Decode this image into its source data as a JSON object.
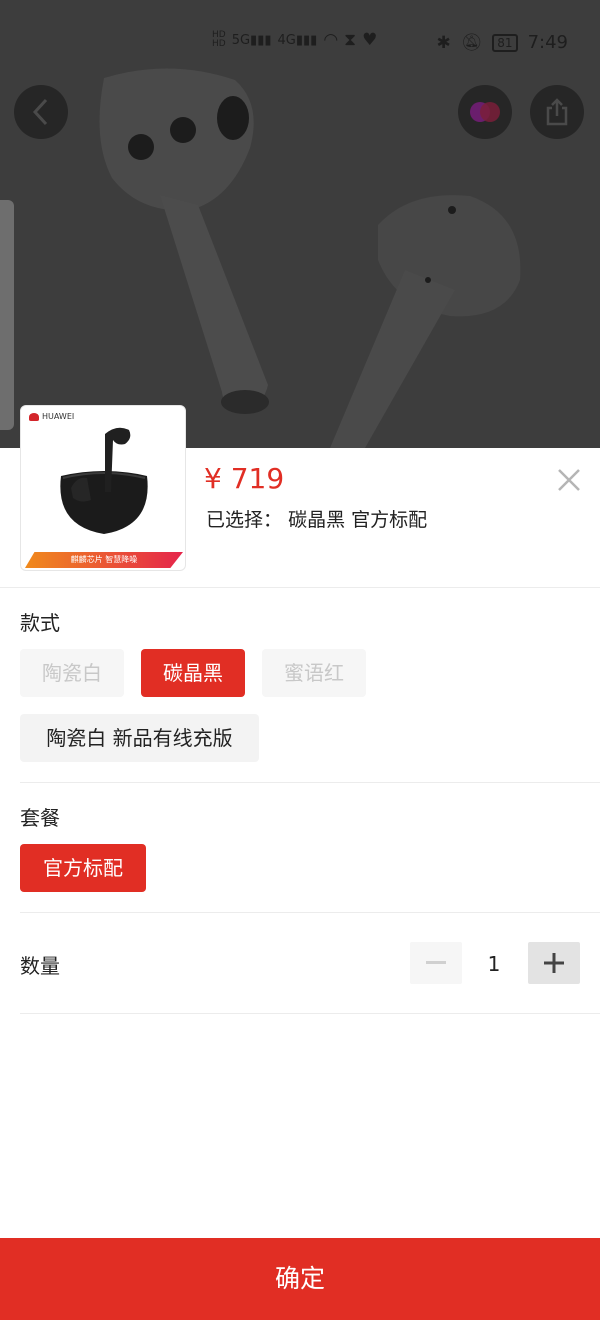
{
  "status_bar": {
    "left_icons": [
      "hd-icon",
      "signal-5g-icon",
      "signal-4g-icon",
      "wifi-icon",
      "hourglass-icon",
      "health-icon"
    ],
    "battery": "81",
    "time": "7:49"
  },
  "header_icons": [
    "back-icon",
    "color-swatch-icon",
    "share-icon"
  ],
  "product": {
    "thumb_brand": "HUAWEI",
    "thumb_ribbon": "麒麟芯片 智慧降噪",
    "price": "¥ 719",
    "selected_label": "已选择：",
    "selected_value": "碳晶黑 官方标配"
  },
  "style_section": {
    "title": "款式",
    "options": [
      {
        "label": "陶瓷白",
        "state": "disabled"
      },
      {
        "label": "碳晶黑",
        "state": "active"
      },
      {
        "label": "蜜语红",
        "state": "disabled"
      },
      {
        "label": "陶瓷白 新品有线充版",
        "state": "normal"
      }
    ]
  },
  "package_section": {
    "title": "套餐",
    "options": [
      {
        "label": "官方标配",
        "state": "active"
      }
    ]
  },
  "quantity": {
    "label": "数量",
    "value": "1",
    "minus_label": "−",
    "plus_label": "+"
  },
  "confirm_label": "确定",
  "colors": {
    "accent": "#e12e24",
    "chip_bg": "#f3f3f3",
    "disabled_text": "#c8c8c8"
  }
}
